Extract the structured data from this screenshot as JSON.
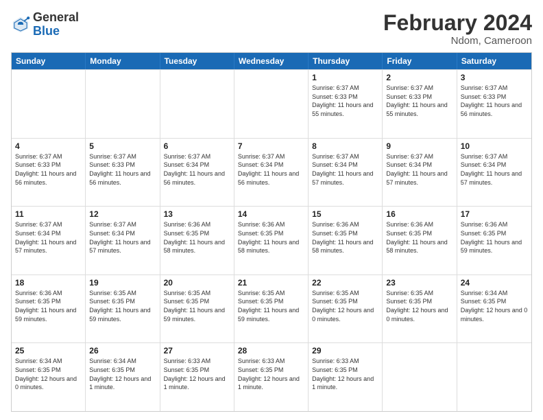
{
  "logo": {
    "general": "General",
    "blue": "Blue"
  },
  "title": "February 2024",
  "location": "Ndom, Cameroon",
  "header_days": [
    "Sunday",
    "Monday",
    "Tuesday",
    "Wednesday",
    "Thursday",
    "Friday",
    "Saturday"
  ],
  "rows": [
    [
      {
        "day": "",
        "info": ""
      },
      {
        "day": "",
        "info": ""
      },
      {
        "day": "",
        "info": ""
      },
      {
        "day": "",
        "info": ""
      },
      {
        "day": "1",
        "info": "Sunrise: 6:37 AM\nSunset: 6:33 PM\nDaylight: 11 hours\nand 55 minutes."
      },
      {
        "day": "2",
        "info": "Sunrise: 6:37 AM\nSunset: 6:33 PM\nDaylight: 11 hours\nand 55 minutes."
      },
      {
        "day": "3",
        "info": "Sunrise: 6:37 AM\nSunset: 6:33 PM\nDaylight: 11 hours\nand 56 minutes."
      }
    ],
    [
      {
        "day": "4",
        "info": "Sunrise: 6:37 AM\nSunset: 6:33 PM\nDaylight: 11 hours\nand 56 minutes."
      },
      {
        "day": "5",
        "info": "Sunrise: 6:37 AM\nSunset: 6:33 PM\nDaylight: 11 hours\nand 56 minutes."
      },
      {
        "day": "6",
        "info": "Sunrise: 6:37 AM\nSunset: 6:34 PM\nDaylight: 11 hours\nand 56 minutes."
      },
      {
        "day": "7",
        "info": "Sunrise: 6:37 AM\nSunset: 6:34 PM\nDaylight: 11 hours\nand 56 minutes."
      },
      {
        "day": "8",
        "info": "Sunrise: 6:37 AM\nSunset: 6:34 PM\nDaylight: 11 hours\nand 57 minutes."
      },
      {
        "day": "9",
        "info": "Sunrise: 6:37 AM\nSunset: 6:34 PM\nDaylight: 11 hours\nand 57 minutes."
      },
      {
        "day": "10",
        "info": "Sunrise: 6:37 AM\nSunset: 6:34 PM\nDaylight: 11 hours\nand 57 minutes."
      }
    ],
    [
      {
        "day": "11",
        "info": "Sunrise: 6:37 AM\nSunset: 6:34 PM\nDaylight: 11 hours\nand 57 minutes."
      },
      {
        "day": "12",
        "info": "Sunrise: 6:37 AM\nSunset: 6:34 PM\nDaylight: 11 hours\nand 57 minutes."
      },
      {
        "day": "13",
        "info": "Sunrise: 6:36 AM\nSunset: 6:35 PM\nDaylight: 11 hours\nand 58 minutes."
      },
      {
        "day": "14",
        "info": "Sunrise: 6:36 AM\nSunset: 6:35 PM\nDaylight: 11 hours\nand 58 minutes."
      },
      {
        "day": "15",
        "info": "Sunrise: 6:36 AM\nSunset: 6:35 PM\nDaylight: 11 hours\nand 58 minutes."
      },
      {
        "day": "16",
        "info": "Sunrise: 6:36 AM\nSunset: 6:35 PM\nDaylight: 11 hours\nand 58 minutes."
      },
      {
        "day": "17",
        "info": "Sunrise: 6:36 AM\nSunset: 6:35 PM\nDaylight: 11 hours\nand 59 minutes."
      }
    ],
    [
      {
        "day": "18",
        "info": "Sunrise: 6:36 AM\nSunset: 6:35 PM\nDaylight: 11 hours\nand 59 minutes."
      },
      {
        "day": "19",
        "info": "Sunrise: 6:35 AM\nSunset: 6:35 PM\nDaylight: 11 hours\nand 59 minutes."
      },
      {
        "day": "20",
        "info": "Sunrise: 6:35 AM\nSunset: 6:35 PM\nDaylight: 11 hours\nand 59 minutes."
      },
      {
        "day": "21",
        "info": "Sunrise: 6:35 AM\nSunset: 6:35 PM\nDaylight: 11 hours\nand 59 minutes."
      },
      {
        "day": "22",
        "info": "Sunrise: 6:35 AM\nSunset: 6:35 PM\nDaylight: 12 hours\nand 0 minutes."
      },
      {
        "day": "23",
        "info": "Sunrise: 6:35 AM\nSunset: 6:35 PM\nDaylight: 12 hours\nand 0 minutes."
      },
      {
        "day": "24",
        "info": "Sunrise: 6:34 AM\nSunset: 6:35 PM\nDaylight: 12 hours\nand 0 minutes."
      }
    ],
    [
      {
        "day": "25",
        "info": "Sunrise: 6:34 AM\nSunset: 6:35 PM\nDaylight: 12 hours\nand 0 minutes."
      },
      {
        "day": "26",
        "info": "Sunrise: 6:34 AM\nSunset: 6:35 PM\nDaylight: 12 hours\nand 1 minute."
      },
      {
        "day": "27",
        "info": "Sunrise: 6:33 AM\nSunset: 6:35 PM\nDaylight: 12 hours\nand 1 minute."
      },
      {
        "day": "28",
        "info": "Sunrise: 6:33 AM\nSunset: 6:35 PM\nDaylight: 12 hours\nand 1 minute."
      },
      {
        "day": "29",
        "info": "Sunrise: 6:33 AM\nSunset: 6:35 PM\nDaylight: 12 hours\nand 1 minute."
      },
      {
        "day": "",
        "info": ""
      },
      {
        "day": "",
        "info": ""
      }
    ]
  ]
}
